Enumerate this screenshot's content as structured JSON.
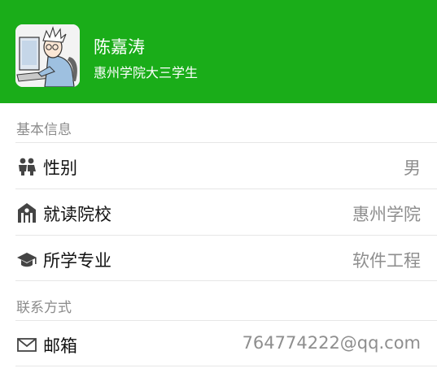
{
  "profile": {
    "name": "陈嘉涛",
    "subtitle": "惠州学院大三学生"
  },
  "colors": {
    "header_bg": "#1aad19",
    "section_label": "#8b8b8b",
    "value_text": "#8e8e8e"
  },
  "basic_info": {
    "section_title": "基本信息",
    "items": [
      {
        "icon": "people-icon",
        "label": "性别",
        "value": "男"
      },
      {
        "icon": "school-building-icon",
        "label": "就读院校",
        "value": "惠州学院"
      },
      {
        "icon": "graduation-cap-icon",
        "label": "所学专业",
        "value": "软件工程"
      }
    ]
  },
  "contact": {
    "section_title": "联系方式",
    "items": [
      {
        "icon": "mail-icon",
        "label": "邮箱",
        "value": "764774222@qq.com"
      }
    ]
  }
}
